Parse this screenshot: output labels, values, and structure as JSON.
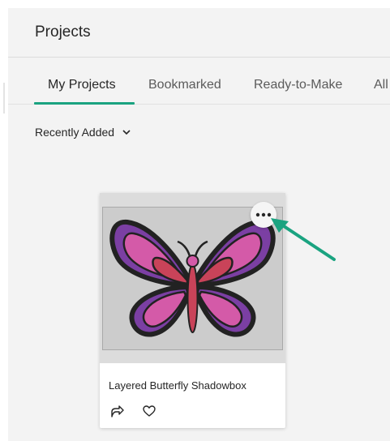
{
  "header": {
    "title": "Projects"
  },
  "tabs": [
    {
      "label": "My Projects",
      "active": true
    },
    {
      "label": "Bookmarked"
    },
    {
      "label": "Ready-to-Make"
    },
    {
      "label": "All"
    }
  ],
  "sort": {
    "label": "Recently Added"
  },
  "card": {
    "title": "Layered Butterfly Shadowbox",
    "more_icon": "more-horizontal-icon",
    "share_icon": "share-icon",
    "bookmark_icon": "heart-icon"
  },
  "colors": {
    "accent": "#1aa380",
    "arrow": "#1aa380",
    "butterfly_outer": "#7b3fa3",
    "butterfly_inner": "#d45aa8",
    "butterfly_center": "#c94359",
    "butterfly_outline": "#222222"
  }
}
